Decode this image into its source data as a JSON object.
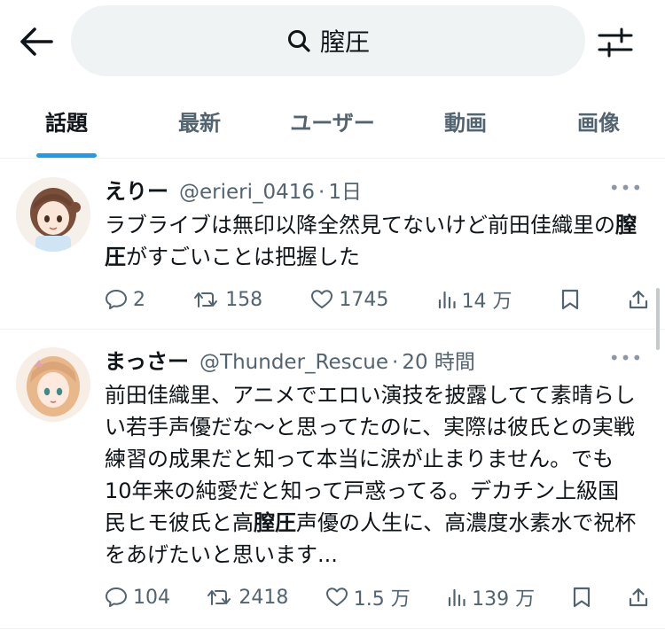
{
  "search": {
    "query": "膣圧"
  },
  "tabs": [
    {
      "label": "話題"
    },
    {
      "label": "最新"
    },
    {
      "label": "ユーザー"
    },
    {
      "label": "動画"
    },
    {
      "label": "画像"
    }
  ],
  "tweets": [
    {
      "display_name": "えりー",
      "handle": "@erieri_0416",
      "time": "1日",
      "text_before": "ラブライブは無印以降全然見てないけど前田佳織里の",
      "highlight": "膣圧",
      "text_after": "がすごいことは把握した",
      "replies": "2",
      "retweets": "158",
      "likes": "1745",
      "views": "14 万"
    },
    {
      "display_name": "まっさー",
      "handle": "@Thunder_Rescue",
      "time": "20 時間",
      "text_before": "前田佳織里、アニメでエロい演技を披露してて素晴らしい若手声優だな〜と思ってたのに、実際は彼氏との実戦練習の成果だと知って本当に涙が止まりません。でも10年来の純愛だと知って戸惑ってる。デカチン上級国民ヒモ彼氏と高",
      "highlight": "膣圧",
      "text_after": "声優の人生に、高濃度水素水で祝杯をあげたいと思います...",
      "replies": "104",
      "retweets": "2418",
      "likes": "1.5 万",
      "views": "139 万"
    }
  ],
  "colors": {
    "accent": "#1d9bf0",
    "secondary_text": "#536471",
    "primary_text": "#0f1419"
  },
  "icons": [
    "back-arrow-icon",
    "search-icon",
    "filter-icon",
    "more-icon",
    "reply-icon",
    "retweet-icon",
    "like-icon",
    "views-icon",
    "bookmark-icon",
    "share-icon"
  ]
}
